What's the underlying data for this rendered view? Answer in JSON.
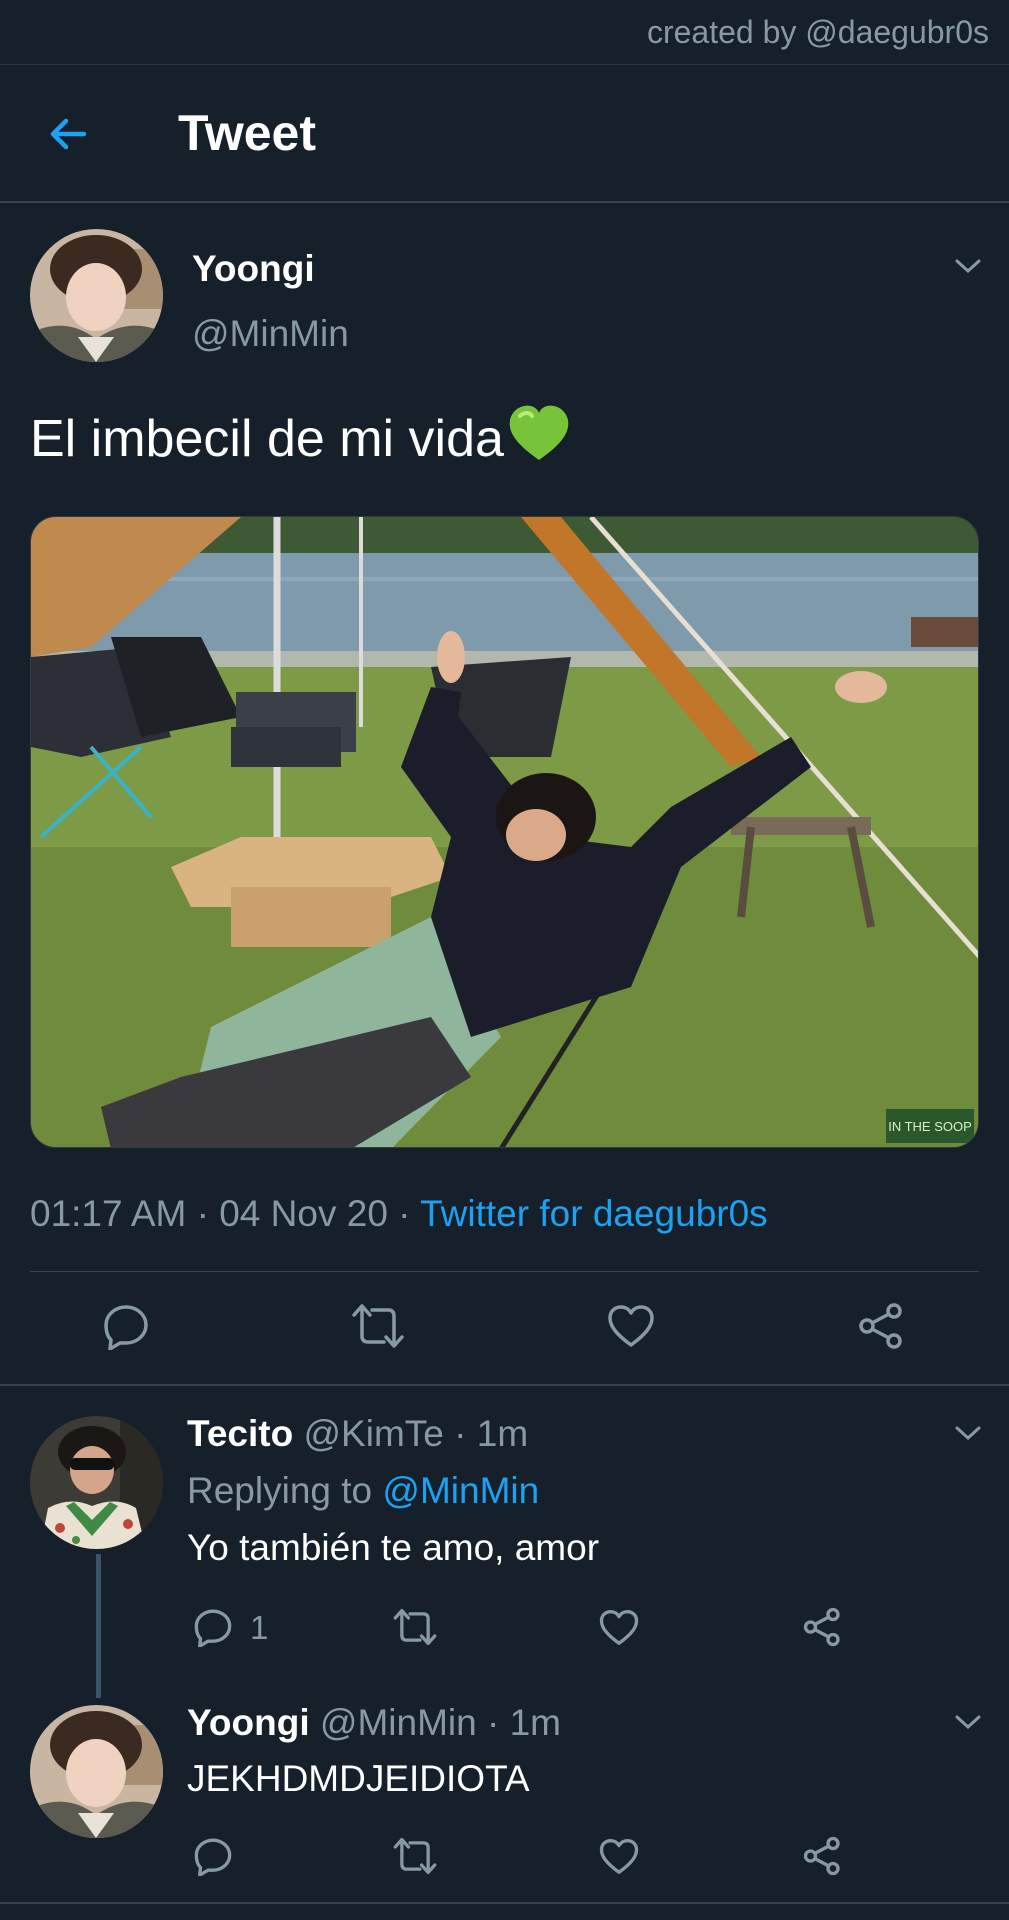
{
  "watermark": "created by @daegubr0s",
  "header": {
    "title": "Tweet"
  },
  "tweet": {
    "author_name": "Yoongi",
    "author_handle": "@MinMin",
    "text": "El imbecil de mi vida",
    "emoji": "💚",
    "photo_badge": "IN THE SOOP",
    "meta_time": "01:17 AM",
    "meta_sep1": " · ",
    "meta_date": "04 Nov 20",
    "meta_sep2": " · ",
    "meta_source": "Twitter for daegubr0s"
  },
  "replies": [
    {
      "name": "Tecito",
      "handle": "@KimTe",
      "time": " · 1m",
      "replying_prefix": "Replying to ",
      "replying_handle": "@MinMin",
      "text": "Yo también te amo, amor",
      "reply_count": "1"
    },
    {
      "name": "Yoongi",
      "handle": "@MinMin",
      "time": " · 1m",
      "text": "JEKHDMDJEIDIOTA"
    }
  ],
  "colors": {
    "background": "#15202b",
    "accent": "#1da1f2",
    "muted": "#8899a6",
    "divider": "#38444d"
  }
}
